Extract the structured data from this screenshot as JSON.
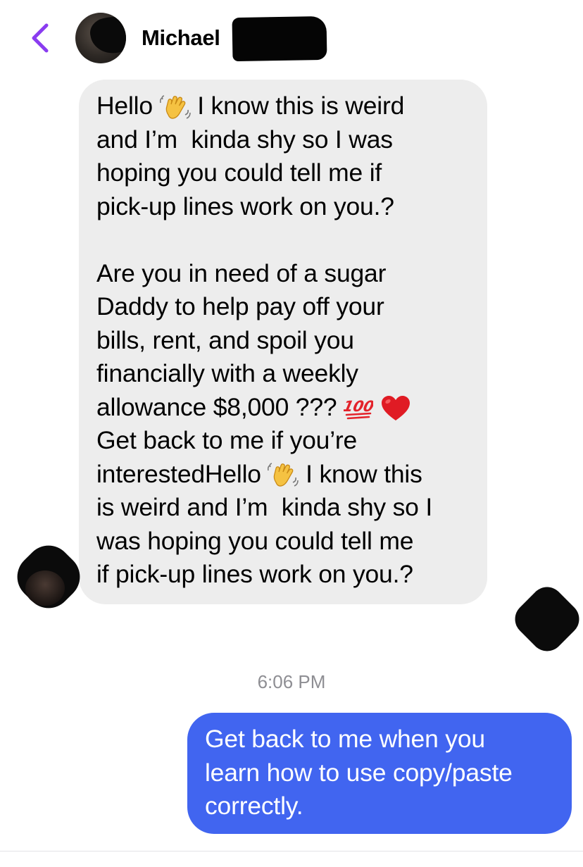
{
  "header": {
    "back_icon": "chevron-left-icon",
    "contact_name": "Michael",
    "accent_color": "#8a3cf0"
  },
  "conversation": {
    "incoming_message": {
      "lines": [
        [
          "Hello ",
          "wave",
          " I know this is weird"
        ],
        [
          "and I’m  kinda shy so I was"
        ],
        [
          "hoping you could tell me if"
        ],
        [
          "pick-up lines work on you.?"
        ],
        [
          ""
        ],
        [
          "Are you in need of a sugar"
        ],
        [
          "Daddy to help pay off your"
        ],
        [
          "bills, rent, and spoil you"
        ],
        [
          "financially with a weekly"
        ],
        [
          "allowance $8,000 ??? ",
          "hundred",
          " ",
          "heart"
        ],
        [
          "Get back to me if you’re"
        ],
        [
          "interestedHello ",
          "wave",
          " I know this"
        ],
        [
          "is weird and I’m  kinda shy so I"
        ],
        [
          "was hoping you could tell me"
        ],
        [
          "if pick-up lines work on you.?"
        ]
      ],
      "bubble_color": "#ededed"
    },
    "timestamp": "6:06 PM",
    "outgoing_message": {
      "lines": [
        "Get back to me when you",
        "learn how to use copy/paste",
        "correctly."
      ],
      "bubble_color": "#4165f0"
    }
  }
}
